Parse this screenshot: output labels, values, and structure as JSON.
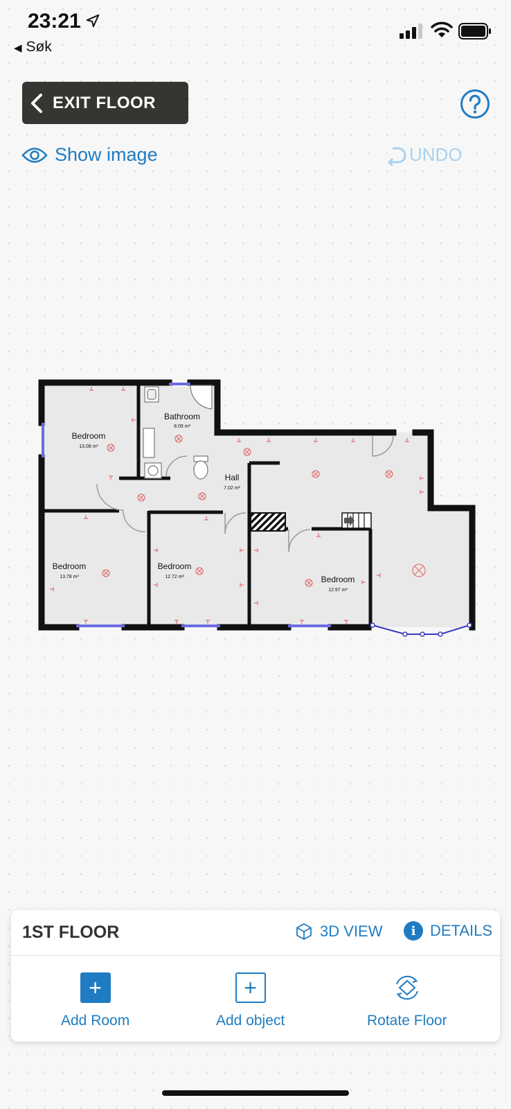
{
  "status_bar": {
    "time": "23:21",
    "back_label": "Søk"
  },
  "toolbar": {
    "exit_label": "EXIT FLOOR",
    "show_image_label": "Show image",
    "undo_label": "UNDO"
  },
  "floorplan": {
    "rooms": [
      {
        "name": "Bedroom",
        "area": "13.08 m²"
      },
      {
        "name": "Bathroom",
        "area": "8.09 m²"
      },
      {
        "name": "Hall",
        "area": "7.02 m²"
      },
      {
        "name": "Bedroom",
        "area": "13.78 m²"
      },
      {
        "name": "Bedroom",
        "area": "12.72 m²"
      },
      {
        "name": "Bedroom",
        "area": "12.97 m²"
      }
    ]
  },
  "panel": {
    "floor_title": "1ST FLOOR",
    "view_3d_label": "3D VIEW",
    "details_label": "DETAILS",
    "actions": [
      {
        "label": "Add Room",
        "icon": "plus-filled-icon"
      },
      {
        "label": "Add object",
        "icon": "plus-outline-icon"
      },
      {
        "label": "Rotate Floor",
        "icon": "rotate-icon"
      }
    ]
  },
  "colors": {
    "accent": "#1f7cc2",
    "dark_button": "#333631",
    "undo_disabled": "#a9d1ef",
    "window_blue": "#6b6be0",
    "fixture_red": "#e07070"
  }
}
